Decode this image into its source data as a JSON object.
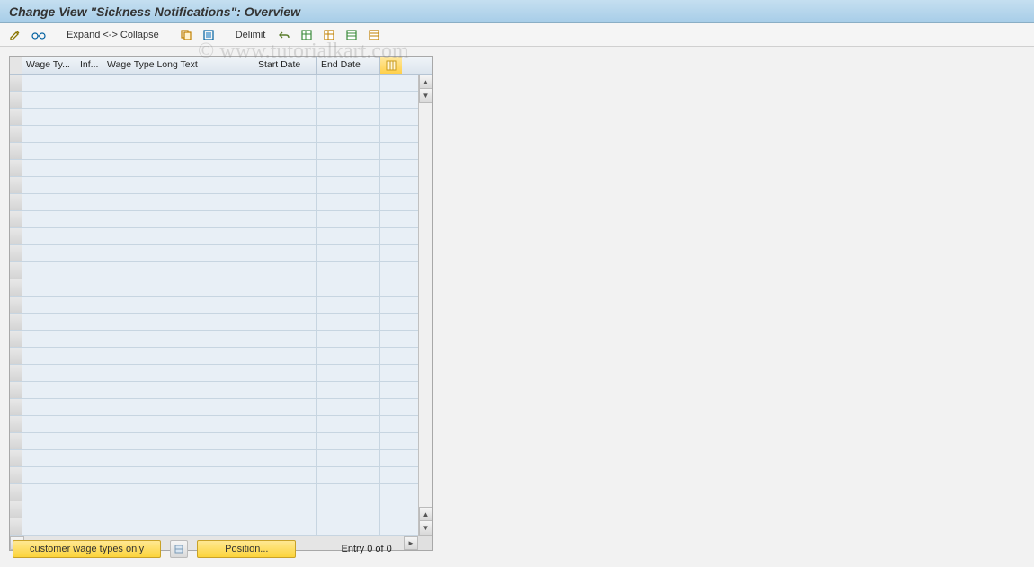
{
  "title": "Change View \"Sickness Notifications\": Overview",
  "toolbar": {
    "expand_collapse": "Expand <-> Collapse",
    "delimit": "Delimit"
  },
  "columns": {
    "wage_type": "Wage Ty...",
    "inf": "Inf...",
    "long_text": "Wage Type Long Text",
    "start_date": "Start Date",
    "end_date": "End Date"
  },
  "rows_count": 27,
  "footer": {
    "customer_filter": "customer wage types only",
    "position": "Position...",
    "entry_status": "Entry 0 of 0"
  },
  "watermark": "© www.tutorialkart.com"
}
